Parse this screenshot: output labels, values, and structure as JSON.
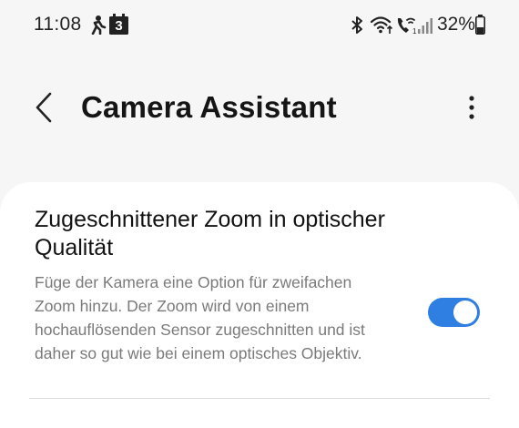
{
  "status_bar": {
    "time": "11:08",
    "calendar_day": "3",
    "battery_percent": "32%",
    "icons": [
      "walking-figure-icon",
      "calendar-icon",
      "bluetooth-icon",
      "wifi-icon",
      "wifi-calling-icon",
      "signal-icon",
      "battery-icon"
    ]
  },
  "header": {
    "title": "Camera Assistant",
    "back_icon": "chevron-left-icon",
    "more_icon": "more-vertical-icon"
  },
  "setting": {
    "title": "Zugeschnittener Zoom in optischer Qualität",
    "description": "Füge der Kamera eine Option für zweifachen Zoom hinzu. Der Zoom wird von einem hochauflösenden Sensor zugeschnitten und ist daher so gut wie bei einem optisches Objektiv.",
    "toggle_on": true
  },
  "colors": {
    "background": "#f6f6f6",
    "card": "#ffffff",
    "accent": "#2f7fe3",
    "description_text": "#7a7a7a"
  }
}
